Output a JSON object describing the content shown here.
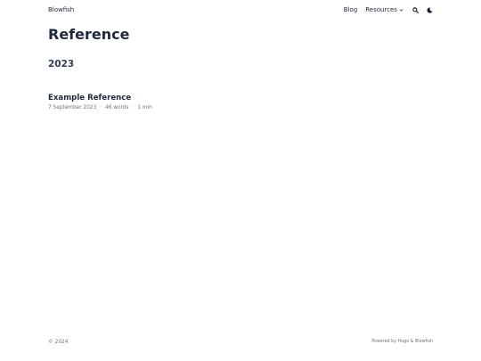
{
  "header": {
    "brand": "Blowfish",
    "nav": {
      "blog": "Blog",
      "resources": "Resources"
    },
    "icons": {
      "search": "search-icon",
      "theme": "moon-icon",
      "dropdown": "chevron-down-icon"
    }
  },
  "main": {
    "title": "Reference",
    "groups": [
      {
        "year": "2023",
        "articles": [
          {
            "title": "Example Reference",
            "date": "7 September 2023",
            "words": "46 words",
            "reading_time": "1 min"
          }
        ]
      }
    ]
  },
  "footer": {
    "copyright": "© 2024",
    "powered_by": "Powered by Hugo & Blowfish"
  },
  "colors": {
    "heading": "#1e293b",
    "text": "#1f2937",
    "muted": "#6b7280",
    "background": "#ffffff"
  }
}
